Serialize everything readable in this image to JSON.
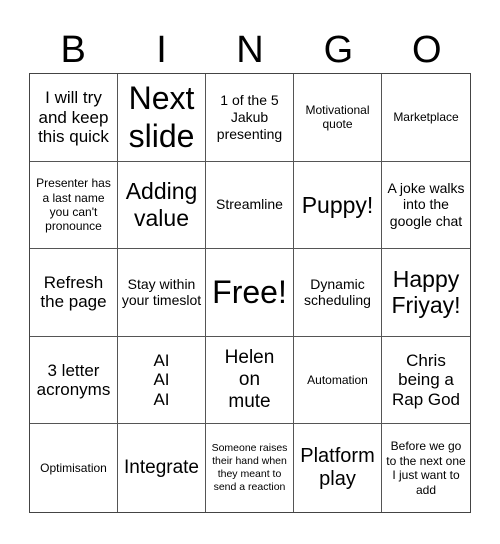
{
  "header": {
    "letters": [
      "B",
      "I",
      "N",
      "G",
      "O"
    ]
  },
  "cells": [
    "I will try and keep this quick",
    "Next slide",
    "1 of the 5 Jakub presenting",
    "Motivational quote",
    "Marketplace",
    "Presenter has a last name you can't pronounce",
    "Adding value",
    "Streamline",
    "Puppy!",
    "A joke walks into the google chat",
    "Refresh the page",
    "Stay within your timeslot",
    "Free!",
    "Dynamic scheduling",
    "Happy Friyay!",
    "3 letter acronyms",
    "AI AI AI",
    "Helen on mute",
    "Automation",
    "Chris being a Rap God",
    "Optimisation",
    "Integrate",
    "Someone raises their hand when they meant to send a reaction",
    "Platform play",
    "Before we go to the next one I just want to add"
  ]
}
